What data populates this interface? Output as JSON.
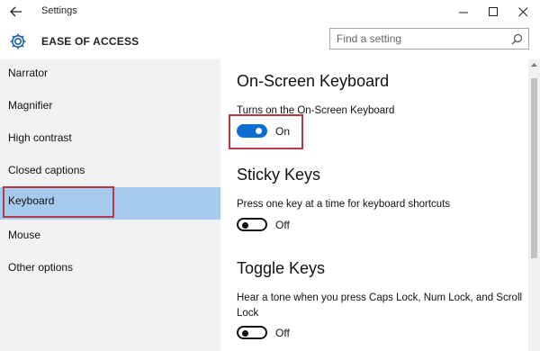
{
  "window": {
    "title": "Settings"
  },
  "header": {
    "section_title": "EASE OF ACCESS",
    "search_placeholder": "Find a setting"
  },
  "sidebar": {
    "items": [
      {
        "label": "Narrator"
      },
      {
        "label": "Magnifier"
      },
      {
        "label": "High contrast"
      },
      {
        "label": "Closed captions"
      },
      {
        "label": "Keyboard",
        "selected": true
      },
      {
        "label": "Mouse"
      },
      {
        "label": "Other options"
      }
    ]
  },
  "main": {
    "sections": [
      {
        "heading": "On-Screen Keyboard",
        "description": "Turns on the On-Screen Keyboard",
        "state": "On"
      },
      {
        "heading": "Sticky Keys",
        "description": "Press one key at a time for keyboard shortcuts",
        "state": "Off"
      },
      {
        "heading": "Toggle Keys",
        "description": "Hear a tone when you press Caps Lock, Num Lock, and Scroll Lock",
        "state": "Off"
      }
    ]
  },
  "colors": {
    "accent": "#0a6ed1",
    "selected_nav": "#a6c9ee",
    "annotation_box": "#b03a48",
    "sidebar_bg": "#f2f2f2"
  },
  "icons": {
    "back": "back-arrow-icon",
    "settings": "gear-icon",
    "search": "search-icon",
    "minimize": "minimize-icon",
    "maximize": "maximize-icon",
    "close": "close-icon"
  }
}
